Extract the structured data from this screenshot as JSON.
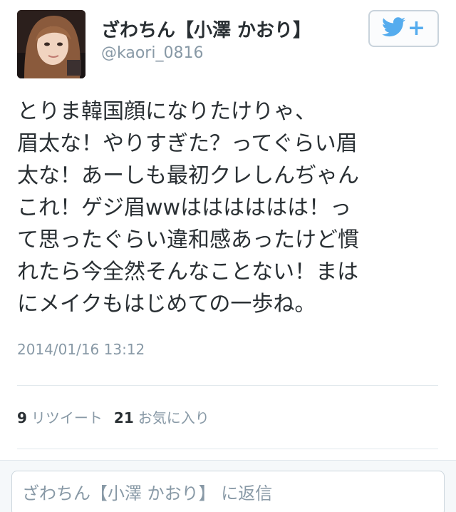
{
  "user": {
    "display_name": "ざわちん【小澤 かおり】",
    "handle": "@kaori_0816"
  },
  "follow_button": {
    "icon": "twitter-bird-icon",
    "plus": "+",
    "accent_color": "#55acee"
  },
  "tweet": {
    "lines": [
      "とりま韓国顔になりたけりゃ、",
      "眉太な！やりすぎた？ってぐらい眉",
      "太な！あーしも最初クレしんぢゃん",
      "これ！ゲジ眉wwはははははは！っ",
      "て思ったぐらい違和感あったけど慣",
      "れたら今全然そんなことない！まは",
      "にメイクもはじめての一歩ね。"
    ],
    "timestamp": "2014/01/16 13:12"
  },
  "stats": {
    "retweets_count": "9",
    "retweets_label": "リツイート",
    "favorites_count": "21",
    "favorites_label": "お気に入り"
  },
  "reply": {
    "placeholder": "ざわちん【小澤 かおり】 に返信"
  }
}
